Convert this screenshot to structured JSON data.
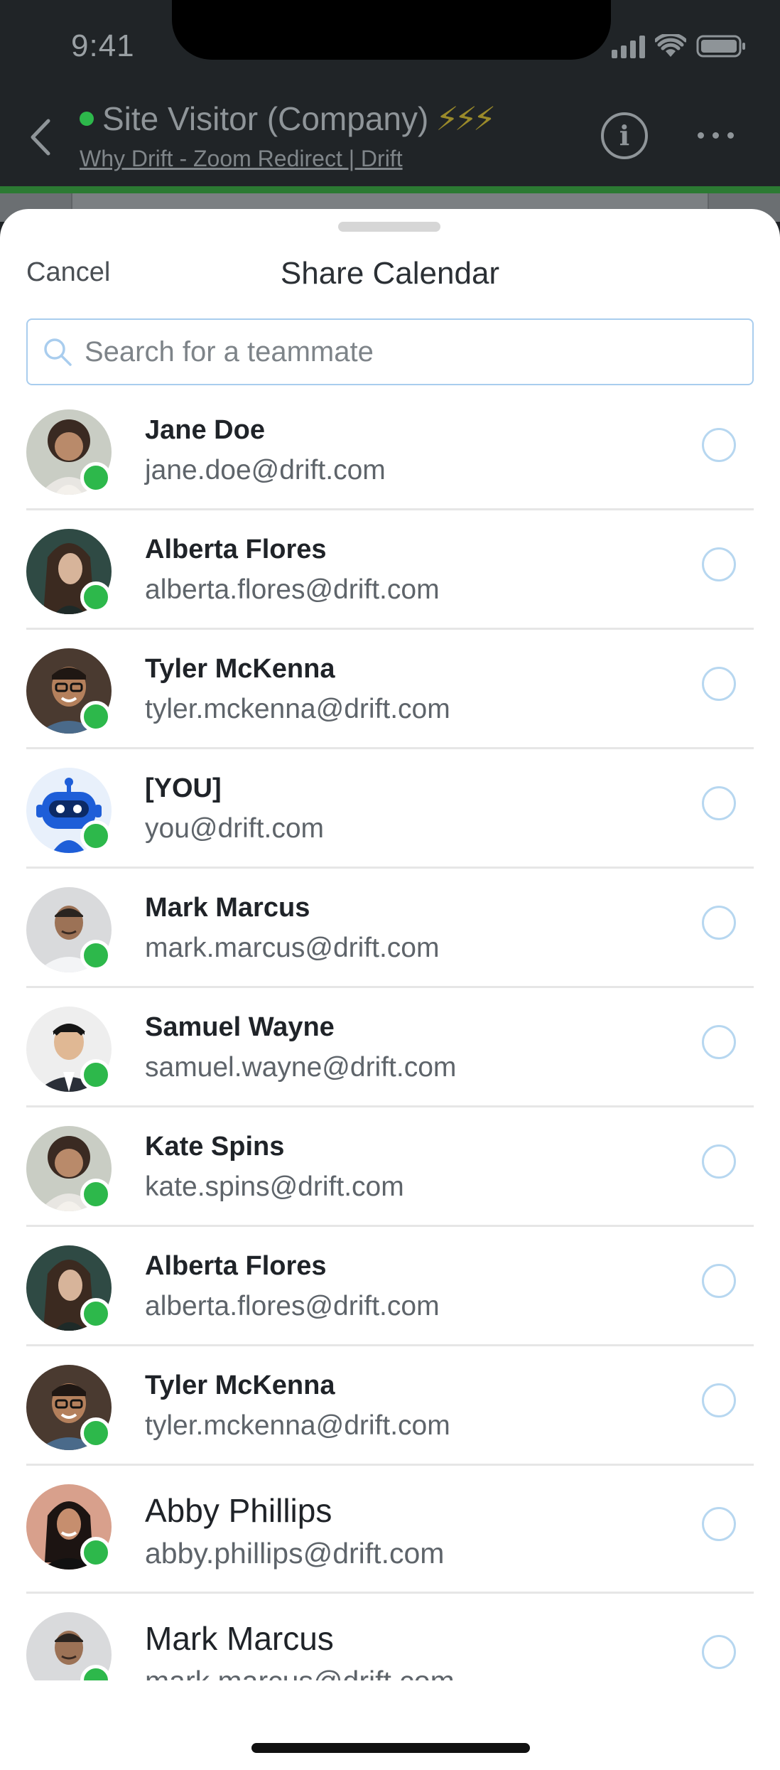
{
  "status_bar": {
    "time": "9:41"
  },
  "nav": {
    "title": "Site Visitor (Company)",
    "bolts": "⚡⚡⚡",
    "subtitle": "Why Drift - Zoom Redirect | Drift"
  },
  "sheet": {
    "cancel_label": "Cancel",
    "title": "Share Calendar",
    "search": {
      "placeholder": "Search for a teammate",
      "value": ""
    }
  },
  "teammates": [
    {
      "name": "Jane Doe",
      "email": "jane.doe@drift.com",
      "avatar": "woman-curly-hair",
      "online": true,
      "selected": false
    },
    {
      "name": "Alberta Flores",
      "email": "alberta.flores@drift.com",
      "avatar": "woman-long-hair",
      "online": true,
      "selected": false
    },
    {
      "name": "Tyler McKenna",
      "email": "tyler.mckenna@drift.com",
      "avatar": "man-glasses",
      "online": true,
      "selected": false
    },
    {
      "name": "[YOU]",
      "email": "you@drift.com",
      "avatar": "bot",
      "online": true,
      "selected": false
    },
    {
      "name": "Mark Marcus",
      "email": "mark.marcus@drift.com",
      "avatar": "man-white-shirt",
      "online": true,
      "selected": false
    },
    {
      "name": "Samuel Wayne",
      "email": "samuel.wayne@drift.com",
      "avatar": "man-suit",
      "online": true,
      "selected": false
    },
    {
      "name": "Kate Spins",
      "email": "kate.spins@drift.com",
      "avatar": "woman-curly-hair",
      "online": true,
      "selected": false
    },
    {
      "name": "Alberta Flores",
      "email": "alberta.flores@drift.com",
      "avatar": "woman-long-hair",
      "online": true,
      "selected": false
    },
    {
      "name": "Tyler McKenna",
      "email": "tyler.mckenna@drift.com",
      "avatar": "man-glasses",
      "online": true,
      "selected": false
    },
    {
      "name": "Abby Phillips",
      "email": "abby.phillips@drift.com",
      "avatar": "woman-dark-hair",
      "online": true,
      "selected": false
    },
    {
      "name": "Mark Marcus",
      "email": "mark.marcus@drift.com",
      "avatar": "man-white-shirt",
      "online": true,
      "selected": false
    }
  ],
  "colors": {
    "online": "#2db84b",
    "accent": "#a9cdee",
    "radio": "#b7d7f0"
  }
}
